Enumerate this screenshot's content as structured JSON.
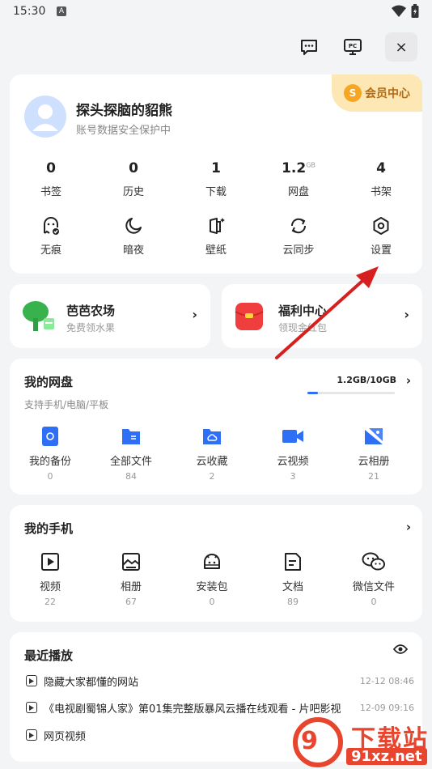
{
  "status_bar": {
    "time": "15:30",
    "notif_letter": "A"
  },
  "top_bar": {
    "close_label": "×"
  },
  "user": {
    "name": "探头探脑的貂熊",
    "subtitle": "账号数据安全保护中",
    "vip_label": "会员中心",
    "vip_coin": "S"
  },
  "stats": [
    {
      "value": "0",
      "unit": "",
      "label": "书签"
    },
    {
      "value": "0",
      "unit": "",
      "label": "历史"
    },
    {
      "value": "1",
      "unit": "",
      "label": "下载"
    },
    {
      "value": "1.2",
      "unit": "GB",
      "label": "网盘"
    },
    {
      "value": "4",
      "unit": "",
      "label": "书架"
    }
  ],
  "tools": [
    {
      "label": "无痕",
      "icon": "ghost-icon"
    },
    {
      "label": "暗夜",
      "icon": "moon-icon"
    },
    {
      "label": "壁纸",
      "icon": "wallpaper-icon"
    },
    {
      "label": "云同步",
      "icon": "sync-icon"
    },
    {
      "label": "设置",
      "icon": "gear-icon"
    }
  ],
  "farm": {
    "title": "芭芭农场",
    "subtitle": "免费领水果",
    "arrow": "›"
  },
  "welfare": {
    "title": "福利中心",
    "subtitle": "领现金红包",
    "arrow": "›"
  },
  "disk": {
    "title": "我的网盘",
    "subtitle": "支持手机/电脑/平板",
    "usage": "1.2GB/10GB",
    "usage_fraction": 0.12,
    "arrow": "›",
    "items": [
      {
        "label": "我的备份",
        "count": "0",
        "icon": "backup-icon"
      },
      {
        "label": "全部文件",
        "count": "84",
        "icon": "file-icon"
      },
      {
        "label": "云收藏",
        "count": "2",
        "icon": "cloud-folder-icon"
      },
      {
        "label": "云视频",
        "count": "3",
        "icon": "video-camera-icon"
      },
      {
        "label": "云相册",
        "count": "21",
        "icon": "photo-icon"
      }
    ]
  },
  "phone": {
    "title": "我的手机",
    "arrow": "›",
    "items": [
      {
        "label": "视频",
        "count": "22",
        "icon": "video-icon"
      },
      {
        "label": "相册",
        "count": "67",
        "icon": "album-icon"
      },
      {
        "label": "安装包",
        "count": "0",
        "icon": "android-icon"
      },
      {
        "label": "文档",
        "count": "89",
        "icon": "document-icon"
      },
      {
        "label": "微信文件",
        "count": "0",
        "icon": "wechat-icon"
      }
    ]
  },
  "recent": {
    "title": "最近播放",
    "items": [
      {
        "text": "隐藏大家都懂的网站",
        "time": "12-12 08:46"
      },
      {
        "text": "《电视剧蜀锦人家》第01集完整版暴风云播在线观看 - 片吧影视",
        "time": "12-09 09:16"
      },
      {
        "text": "网页视频",
        "time": ""
      }
    ]
  },
  "watermark": {
    "glyph": "9",
    "title": "下载站",
    "url": "91xz.net"
  },
  "colors": {
    "accent": "#2f6ff6",
    "annotation_arrow": "#d6201f",
    "vip_bg": "#fde7b5",
    "vip_text": "#b46a10"
  }
}
